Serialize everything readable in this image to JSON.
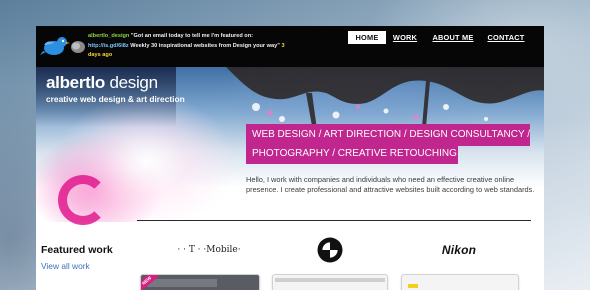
{
  "topbar": {
    "tweet_user": "albertlo_design",
    "tweet_text": "\"Got an email today to tell me I'm featured on:",
    "tweet_link": "http://is.gd/6i8z",
    "tweet_rest": "Weekly 30 inspirational websites from Design your way\"",
    "tweet_time": "3 days ago",
    "icon": "twitter-bird-icon"
  },
  "nav": {
    "items": [
      {
        "label": "HOME",
        "active": true
      },
      {
        "label": "WORK",
        "active": false
      },
      {
        "label": "ABOUT ME",
        "active": false
      },
      {
        "label": "CONTACT",
        "active": false
      }
    ]
  },
  "hero": {
    "brand_bold": "albertlo",
    "brand_light": " design",
    "tagline": "creative web design & art direction",
    "banner_line1": "WEB DESIGN / ART DIRECTION / DESIGN CONSULTANCY /",
    "banner_line2": "PHOTOGRAPHY / CREATIVE RETOUCHING",
    "intro": "Hello, I work with companies and individuals who need an effective creative online presence. I create professional and attractive websites built according to web standards."
  },
  "featured": {
    "title": "Featured work",
    "link": "View all work",
    "clients": [
      {
        "name": "· · T · ·Mobile·",
        "icon": "tmobile-logo"
      },
      {
        "name": "",
        "icon": "bmw-logo"
      },
      {
        "name": "Nikon",
        "icon": "nikon-logo"
      }
    ],
    "badge": "NEW"
  },
  "colors": {
    "accent": "#c1268f",
    "link": "#3a74b8",
    "topbar": "#060606"
  }
}
